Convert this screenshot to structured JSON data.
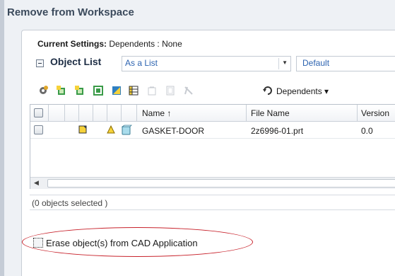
{
  "window": {
    "title": "Remove from Workspace"
  },
  "settings": {
    "label": "Current Settings:",
    "value": "Dependents : None"
  },
  "object_list": {
    "label": "Object List",
    "display_mode": "As a List",
    "filter": "Default"
  },
  "toolbar": {
    "icons": [
      "settings-gear-icon",
      "add-object-icon",
      "add-dependents-icon",
      "add-all-icon",
      "tag-icon",
      "table-columns-icon",
      "clear-icon",
      "copy-icon",
      "remove-icon",
      "refresh-icon"
    ],
    "dependents_label": "Dependents ▾"
  },
  "table": {
    "columns": {
      "name": "Name ↑",
      "file_name": "File Name",
      "version": "Version"
    },
    "rows": [
      {
        "name": "GASKET-DOOR",
        "file_name": "2z6996-01.prt",
        "version": "0.0"
      }
    ]
  },
  "status": {
    "text": "(0 objects selected )"
  },
  "erase_option": {
    "label": "Erase object(s) from CAD Application",
    "checked": false
  },
  "colors": {
    "title": "#3b4a5c",
    "link": "#2c63b0",
    "highlight_ring": "#c8232c"
  }
}
